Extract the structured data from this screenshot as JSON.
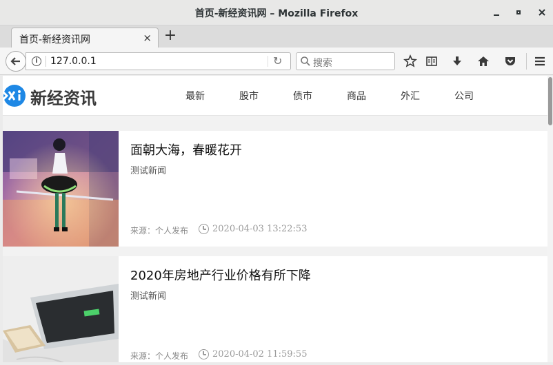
{
  "window": {
    "title": "首页-新经资讯网 – Mozilla Firefox"
  },
  "tabs": [
    {
      "label": "首页-新经资讯网",
      "close_glyph": "×"
    }
  ],
  "newtab_glyph": "+",
  "navbar": {
    "url": "127.0.0.1",
    "search_placeholder": "搜索",
    "icons": [
      "back-arrow-icon",
      "info-icon",
      "reload-icon",
      "search-icon",
      "bookmark-star-icon",
      "reading-list-icon",
      "download-icon",
      "home-icon",
      "pocket-icon",
      "menu-icon"
    ]
  },
  "site": {
    "logo_text": "新经资讯",
    "nav": [
      "最新",
      "股市",
      "债市",
      "商品",
      "外汇",
      "公司"
    ]
  },
  "articles": [
    {
      "title": "面朝大海，春暖花开",
      "tag": "测试新闻",
      "source": "来源：个人发布",
      "time": "2020-04-03 13:22:53"
    },
    {
      "title": "2020年房地产行业价格有所下降",
      "tag": "测试新闻",
      "source": "来源：个人发布",
      "time": "2020-04-02 11:59:55"
    }
  ],
  "colors": {
    "logo_blue": "#1e88e5",
    "nav_text": "#333333",
    "meta_text": "#999999"
  }
}
